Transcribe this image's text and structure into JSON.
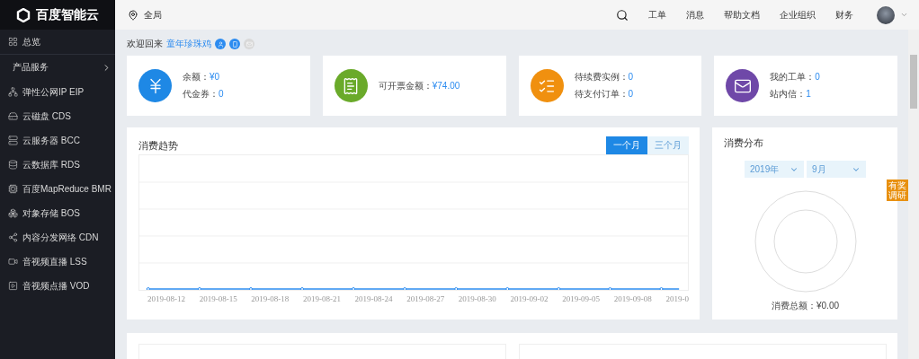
{
  "brand": {
    "name": "百度智能云"
  },
  "header": {
    "region": "全局",
    "nav": [
      "工单",
      "消息",
      "帮助文档",
      "企业组织",
      "财务"
    ]
  },
  "sidebar": {
    "items": [
      {
        "kind": "link",
        "label": "总览"
      },
      {
        "kind": "section",
        "label": "产品服务"
      },
      {
        "kind": "link",
        "label": "弹性公网IP EIP"
      },
      {
        "kind": "link",
        "label": "云磁盘 CDS"
      },
      {
        "kind": "link",
        "label": "云服务器 BCC"
      },
      {
        "kind": "link",
        "label": "云数据库 RDS"
      },
      {
        "kind": "link",
        "label": "百度MapReduce BMR"
      },
      {
        "kind": "link",
        "label": "对象存储 BOS"
      },
      {
        "kind": "link",
        "label": "内容分发网络 CDN"
      },
      {
        "kind": "link",
        "label": "音视频直播 LSS"
      },
      {
        "kind": "link",
        "label": "音视频点播 VOD"
      }
    ]
  },
  "welcome": {
    "text": "欢迎回来",
    "user": "童年珍珠鸡",
    "badges": [
      {
        "active": true
      },
      {
        "active": true
      },
      {
        "active": false
      }
    ]
  },
  "stats": [
    {
      "color": "#1e88e5",
      "lines": [
        {
          "label": "余额：",
          "value": "¥0"
        },
        {
          "label": "代金券：",
          "value": "0"
        }
      ]
    },
    {
      "color": "#6aaa2a",
      "lines": [
        {
          "label": "可开票金额：",
          "value": "¥74.00"
        }
      ]
    },
    {
      "color": "#f0900f",
      "lines": [
        {
          "label": "待续费实例：",
          "value": "0"
        },
        {
          "label": "待支付订单：",
          "value": "0"
        }
      ]
    },
    {
      "color": "#6f48a8",
      "lines": [
        {
          "label": "我的工单：",
          "value": "0"
        },
        {
          "label": "站内信：",
          "value": "1"
        }
      ]
    }
  ],
  "trend": {
    "title": "消费趋势",
    "tabs": [
      {
        "label": "一个月",
        "selected": true
      },
      {
        "label": "三个月",
        "selected": false
      }
    ],
    "x_labels": [
      "2019-08-12",
      "2019-08-15",
      "2019-08-18",
      "2019-08-21",
      "2019-08-24",
      "2019-08-27",
      "2019-08-30",
      "2019-09-02",
      "2019-09-05",
      "2019-09-08",
      "2019-0"
    ]
  },
  "distribution": {
    "title": "消费分布",
    "selects": [
      "2019年",
      "9月"
    ],
    "total_label": "消费总额：",
    "total": "¥0.00"
  },
  "survey": {
    "label": "有奖调研"
  }
}
